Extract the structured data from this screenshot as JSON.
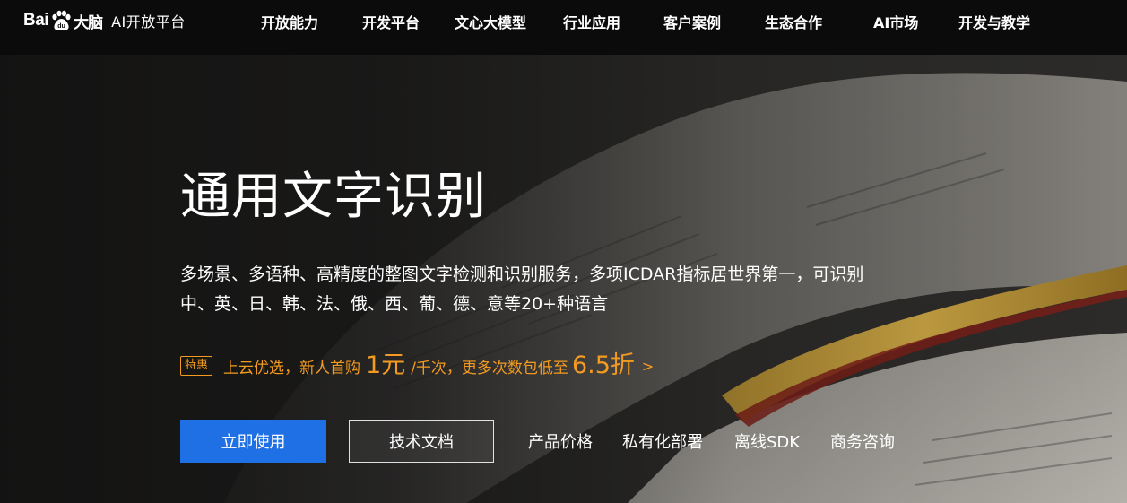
{
  "brand": {
    "logo_bai": "Bai",
    "logo_du": "du",
    "logo_brain": "大脑",
    "platform": "AI开放平台"
  },
  "nav": {
    "items": [
      {
        "label": "开放能力"
      },
      {
        "label": "开发平台"
      },
      {
        "label": "文心大模型"
      },
      {
        "label": "行业应用"
      },
      {
        "label": "客户案例"
      },
      {
        "label": "生态合作"
      },
      {
        "label": "AI市场"
      },
      {
        "label": "开发与教学"
      }
    ]
  },
  "hero": {
    "title": "通用文字识别",
    "description": "多场景、多语种、高精度的整图文字检测和识别服务，多项ICDAR指标居世界第一，可识别中、英、日、韩、法、俄、西、葡、德、意等20+种语言",
    "promo": {
      "badge": "特惠",
      "text_1": "上云优选，新人首购",
      "price": "1元",
      "text_2": "/千次，更多次数包低至",
      "discount": "6.5折",
      "arrow": ">",
      "color": "#f39b20"
    },
    "primary_button": "立即使用",
    "secondary_button": "技术文档",
    "links": [
      "产品价格",
      "私有化部署",
      "离线SDK",
      "商务咨询"
    ],
    "accent_color": "#1f6fe5"
  }
}
